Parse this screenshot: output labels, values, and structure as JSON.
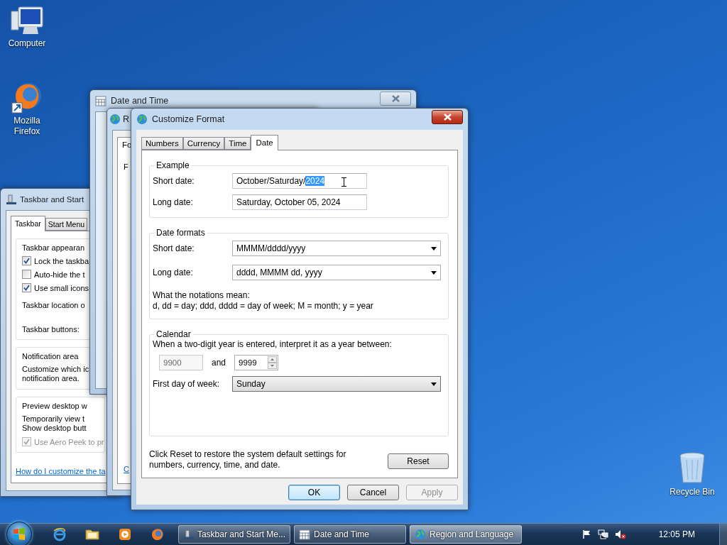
{
  "desktop_icons": [
    {
      "kind": "computer",
      "label": "Computer"
    },
    {
      "kind": "browser",
      "label": "Mozilla Firefox"
    },
    {
      "kind": "recycle_bin",
      "label": "Recycle Bin"
    }
  ],
  "taskbar_properties": {
    "title": "Taskbar and Start",
    "tabs": [
      {
        "label": "Taskbar",
        "selected": true
      },
      {
        "label": "Start Menu",
        "selected": false
      }
    ],
    "appearance": {
      "title": "Taskbar appearan",
      "options": [
        {
          "label": "Lock the taskba",
          "checked": true,
          "disabled": false
        },
        {
          "label": "Auto-hide the t",
          "checked": false,
          "disabled": false
        },
        {
          "label": "Use small icons",
          "checked": true,
          "disabled": false
        }
      ],
      "location_label": "Taskbar location o",
      "buttons_label": "Taskbar buttons:"
    },
    "notification": {
      "title": "Notification area",
      "text": "Customize which ic",
      "text_2": "notification area."
    },
    "preview": {
      "title": "Preview desktop w",
      "text": "Temporarily view t",
      "text_2": "Show desktop butt",
      "option": {
        "label": "Use Aero Peek to pr",
        "checked": true,
        "disabled": true
      }
    },
    "link": "How do I customize the ta"
  },
  "date_time_window": {
    "title": "Date and Time"
  },
  "region_window": {
    "title": "R",
    "tab": "Fo",
    "label": "F",
    "link": "C"
  },
  "dialog": {
    "title": "Customize Format",
    "tabs": [
      {
        "label": "Numbers",
        "selected": false
      },
      {
        "label": "Currency",
        "selected": false
      },
      {
        "label": "Time",
        "selected": false
      },
      {
        "label": "Date",
        "selected": true
      }
    ],
    "example": {
      "title": "Example",
      "short_label": "Short date:",
      "short_value": "October/Saturday/",
      "short_selection": "2024",
      "long_label": "Long date:",
      "long_value": "Saturday, October 05, 2024"
    },
    "formats": {
      "title": "Date formats",
      "rows": [
        {
          "label": "Short date:",
          "value": "MMMM/dddd/yyyy"
        },
        {
          "label": "Long date:",
          "value": "dddd, MMMM dd, yyyy"
        }
      ],
      "notes_title": "What the notations mean:",
      "notes": "d, dd = day;  ddd, dddd = day of week;  M = month;  y = year"
    },
    "calendar": {
      "title": "Calendar",
      "prompt": "When a two-digit year is entered, interpret it as a year between:",
      "from": {
        "value": "9900",
        "disabled": true
      },
      "and_label": "and",
      "to": {
        "value": "9999",
        "disabled": false
      },
      "first_day_label": "First day of week:",
      "first_day_value": "Sunday"
    },
    "reset_note": "Click Reset to restore the system default settings for numbers, currency, time, and date.",
    "reset_button": {
      "label": "Reset",
      "disabled": false,
      "default": false
    },
    "buttons": [
      {
        "label": "OK",
        "disabled": false,
        "default": true
      },
      {
        "label": "Cancel",
        "disabled": false,
        "default": false
      },
      {
        "label": "Apply",
        "disabled": true,
        "default": false
      }
    ]
  },
  "taskbar": {
    "pinned": [
      {
        "kind": "ie"
      },
      {
        "kind": "folder"
      },
      {
        "kind": "media"
      },
      {
        "kind": "firefox"
      }
    ],
    "tasks": [
      {
        "kind": "taskbar",
        "label": "Taskbar and Start Me...",
        "selected": false
      },
      {
        "kind": "clock",
        "label": "Date and Time",
        "selected": false
      },
      {
        "kind": "globe",
        "label": "Region and Language",
        "selected": true
      }
    ],
    "clock": "12:05 PM"
  }
}
